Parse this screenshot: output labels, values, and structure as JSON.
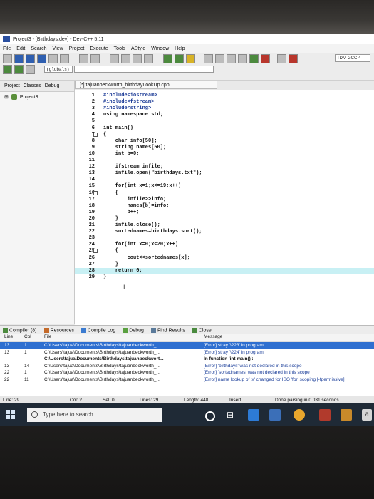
{
  "window": {
    "title": "Project3 - [Birthdays.dev] - Dev-C++ 5.11"
  },
  "menu": [
    "File",
    "Edit",
    "Search",
    "View",
    "Project",
    "Execute",
    "Tools",
    "AStyle",
    "Window",
    "Help"
  ],
  "toolbar": {
    "compiler": "TDM-GCC 4",
    "class_selector": "(globals)"
  },
  "left_panel": {
    "tabs": [
      "Project",
      "Classes",
      "Debug"
    ],
    "tree_root": "Project3"
  },
  "editor": {
    "tab_label": "[*] tajuanbeckworth_birthdayLookUp.cpp",
    "lines": [
      {
        "n": "1",
        "text": "#include<iostream>",
        "pp": true
      },
      {
        "n": "2",
        "text": "#include<fstream>",
        "pp": true
      },
      {
        "n": "3",
        "text": "#include<string>",
        "pp": true
      },
      {
        "n": "4",
        "text": "using namespace std;"
      },
      {
        "n": "5",
        "text": ""
      },
      {
        "n": "6",
        "text": "int main()"
      },
      {
        "n": "7",
        "text": "{",
        "fold": true
      },
      {
        "n": "8",
        "text": "    char info[50];"
      },
      {
        "n": "9",
        "text": "    string names[50];"
      },
      {
        "n": "10",
        "text": "    int b=0;"
      },
      {
        "n": "11",
        "text": ""
      },
      {
        "n": "12",
        "text": "    ifstream infile;"
      },
      {
        "n": "13",
        "text": "    infile.open(\"birthdays.txt\");"
      },
      {
        "n": "14",
        "text": ""
      },
      {
        "n": "15",
        "text": "    for(int x=1;x<=19;x++)"
      },
      {
        "n": "16",
        "text": "    {",
        "fold": true
      },
      {
        "n": "17",
        "text": "        infile>>info;"
      },
      {
        "n": "18",
        "text": "        names[b]=info;"
      },
      {
        "n": "19",
        "text": "        b++;"
      },
      {
        "n": "20",
        "text": "    }"
      },
      {
        "n": "21",
        "text": "    infile.close();"
      },
      {
        "n": "22",
        "text": "    sortednames=birthdays.sort();"
      },
      {
        "n": "23",
        "text": ""
      },
      {
        "n": "24",
        "text": "    for(int x=0;x<20;x++)"
      },
      {
        "n": "25",
        "text": "    {",
        "fold": true
      },
      {
        "n": "26",
        "text": "        cout<<sortednames[x];"
      },
      {
        "n": "27",
        "text": "    }"
      },
      {
        "n": "28",
        "text": "    return 0;",
        "highlight": true
      },
      {
        "n": "29",
        "text": "}"
      }
    ]
  },
  "bottom_tabs": [
    "Compiler (8)",
    "Resources",
    "Compile Log",
    "Debug",
    "Find Results",
    "Close"
  ],
  "results": {
    "headers": {
      "line": "Line",
      "col": "Col",
      "file": "File",
      "message": "Message"
    },
    "rows": [
      {
        "line": "13",
        "col": "1",
        "file": "C:\\Users\\tajua\\Documents\\Birthdays\\tajuanbeckworth_...",
        "message": "[Error] stray '\\223' in program",
        "selected": true
      },
      {
        "line": "13",
        "col": "1",
        "file": "C:\\Users\\tajua\\Documents\\Birthdays\\tajuanbeckworth_...",
        "message": "[Error] stray '\\224' in program"
      },
      {
        "line": "",
        "col": "",
        "file": "C:\\Users\\tajua\\Documents\\Birthdays\\tajuanbeckwort...",
        "message": "In function 'int main()':",
        "bold": true
      },
      {
        "line": "13",
        "col": "14",
        "file": "C:\\Users\\tajua\\Documents\\Birthdays\\tajuanbeckworth_...",
        "message": "[Error] 'birthdays' was not declared in this scope"
      },
      {
        "line": "22",
        "col": "1",
        "file": "C:\\Users\\tajua\\Documents\\Birthdays\\tajuanbeckworth_...",
        "message": "[Error] 'sortednames' was not declared in this scope"
      },
      {
        "line": "22",
        "col": "11",
        "file": "C:\\Users\\tajua\\Documents\\Birthdays\\tajuanbeckworth_...",
        "message": "[Error] name lookup of 'x' changed for ISO 'for' scoping [-fpermissive]"
      }
    ]
  },
  "status": {
    "line": "Line: 29",
    "col": "Col: 2",
    "sel": "Sel: 0",
    "lines": "Lines: 29",
    "length": "Length: 448",
    "mode": "Insert",
    "parse": "Done parsing in 0.031 seconds"
  },
  "taskbar": {
    "search_placeholder": "Type here to search"
  },
  "colors": {
    "highlight": "#c8f0f4",
    "selected_row": "#2e6fd0",
    "preprocessor": "#1b3a96"
  }
}
